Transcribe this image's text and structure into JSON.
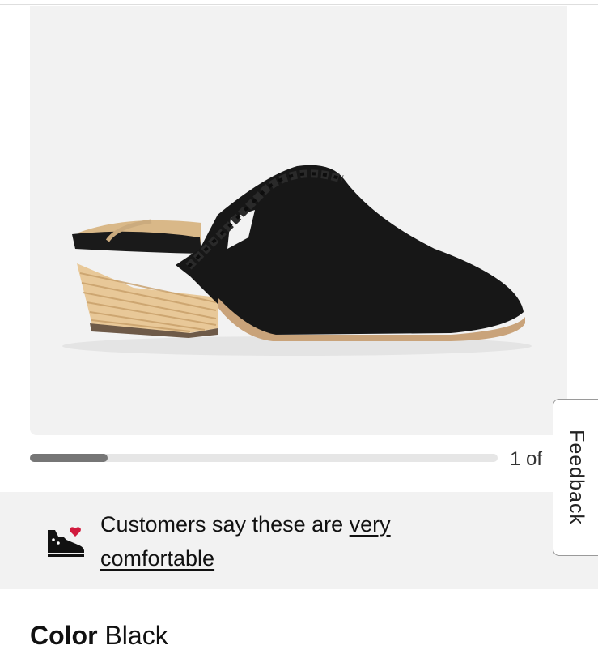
{
  "gallery": {
    "image_alt": "Black suede mule with braided strap and stacked wooden heel",
    "page_counter": "1 of",
    "progress": 0.166
  },
  "reviews_banner": {
    "text_prefix": "Customers say these are ",
    "link_text_line1": "very",
    "link_text_line2": "comfortable",
    "icon": "sneaker-heart-icon"
  },
  "feedback_tab": {
    "label": "Feedback"
  },
  "color_selector": {
    "label": "Color",
    "value": "Black"
  },
  "colors": {
    "heart": "#d11a3d",
    "panel_bg": "#f2f2f2",
    "progress_fill": "#767676",
    "progress_track": "#e6e6e6"
  }
}
